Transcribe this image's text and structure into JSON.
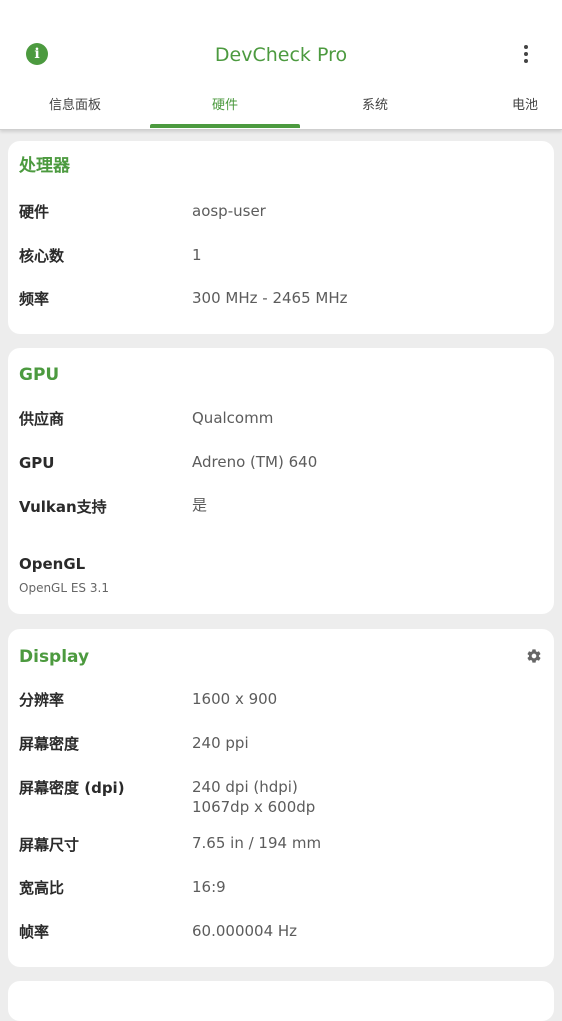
{
  "app": {
    "title": "DevCheck Pro",
    "info_icon": "info-icon",
    "menu_icon": "more-vertical-icon",
    "accent_color": "#4c9a3f"
  },
  "tabs": [
    {
      "label": "信息面板",
      "active": false
    },
    {
      "label": "硬件",
      "active": true
    },
    {
      "label": "系统",
      "active": false
    },
    {
      "label": "电池",
      "active": false
    }
  ],
  "processor": {
    "title": "处理器",
    "rows": [
      {
        "label": "硬件",
        "value": "aosp-user"
      },
      {
        "label": "核心数",
        "value": "1"
      },
      {
        "label": "频率",
        "value": "300 MHz - 2465 MHz"
      }
    ]
  },
  "gpu": {
    "title": "GPU",
    "rows": [
      {
        "label": "供应商",
        "value": "Qualcomm"
      },
      {
        "label": "GPU",
        "value": "Adreno (TM) 640"
      },
      {
        "label": "Vulkan支持",
        "value": "是"
      }
    ],
    "opengl": {
      "label": "OpenGL",
      "value": "OpenGL ES 3.1"
    }
  },
  "display": {
    "title": "Display",
    "settings_icon": "gear-icon",
    "rows": [
      {
        "label": "分辨率",
        "value": "1600 x 900"
      },
      {
        "label": "屏幕密度",
        "value": "240 ppi"
      },
      {
        "label": "屏幕密度 (dpi)",
        "value": "240 dpi (hdpi)",
        "value2": "1067dp x 600dp"
      },
      {
        "label": "屏幕尺寸",
        "value": "7.65 in / 194 mm"
      },
      {
        "label": "宽高比",
        "value": "16:9"
      },
      {
        "label": "帧率",
        "value": "60.000004 Hz"
      }
    ]
  }
}
